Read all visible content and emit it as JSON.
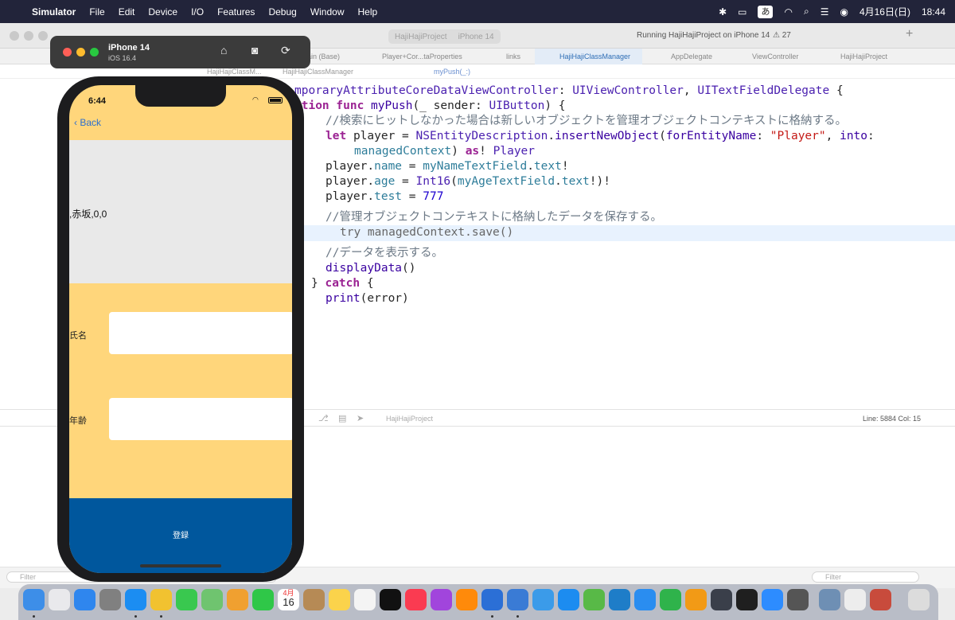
{
  "menubar": {
    "app": "Simulator",
    "items": [
      "File",
      "Edit",
      "Device",
      "I/O",
      "Features",
      "Debug",
      "Window",
      "Help"
    ],
    "input": "あ",
    "date": "4月16日(日)",
    "time": "18:44"
  },
  "xcode": {
    "title": "HajiHajiProject",
    "scheme": "HajiHajiProject",
    "device": "iPhone 14",
    "status": "Running HajiHajiProject on iPhone 14",
    "warnings": "27",
    "tabs": [
      "ain (Base)",
      "Player+Cor...taProperties",
      "links",
      "HajiHajiClassManager",
      "AppDelegate",
      "ViewController",
      "HajiHajiProject"
    ],
    "active_tab": "HajiHajiClassManager",
    "jump": [
      "HajiHajiClassM...",
      "HajiHajiClassManager",
      "myPush(_:)"
    ],
    "code": {
      "l1a": "mporaryAttributeCoreDataViewController",
      "l1b": "UIViewController",
      "l1c": "UITextFieldDelegate",
      "l2a": "ction func",
      "l2b": "myPush",
      "l2c": "(_ sender:",
      "l2d": "UIButton",
      "l3": "//検索にヒットしなかった場合は新しいオブジェクトを管理オブジェクトコンテキストに格納する。",
      "l4": "let",
      "l4b": "player = ",
      "l4c": "NSEntityDescription",
      "l4d": "insertNewObject",
      "l4e": "forEntityName",
      "l4f": "\"Player\"",
      "l4g": "into",
      "l5a": "managedContext",
      "l5b": "as",
      "l5c": "Player",
      "l6a": "player.",
      "l6b": "name",
      "l6c": "myNameTextField",
      "l6d": "text",
      "l7a": "player.",
      "l7b": "age",
      "l7c": "Int16",
      "l7d": "myAgeTextField",
      "l7e": "text",
      "l8a": "player.",
      "l8b": "test",
      "l8c": "777",
      "l9": "//管理オブジェクトコンテキストに格納したデータを保存する。",
      "l10": "try managedContext.save()",
      "l11": "//データを表示する。",
      "l12": "displayData",
      "l13": "catch",
      "l14a": "print",
      "l14b": "(error)"
    },
    "debug_project": "HajiHajiProject",
    "position": "Line: 5884  Col: 15",
    "filter_left": "Filter",
    "filter_right": "Filter"
  },
  "simulator": {
    "device": "iPhone 14",
    "os": "iOS 16.4"
  },
  "phone": {
    "time": "6:44",
    "back": "Back",
    "display_text": ",赤坂,0,0",
    "name_label": "氏名",
    "age_label": "年齢",
    "register": "登録"
  },
  "dock": {
    "calendar_month": "4月",
    "calendar_day": "16"
  },
  "colors": {
    "menubar": "#22243a",
    "phone_bg": "#ffd67b",
    "register_button": "#00579d",
    "accent": "#2c6fcf"
  }
}
